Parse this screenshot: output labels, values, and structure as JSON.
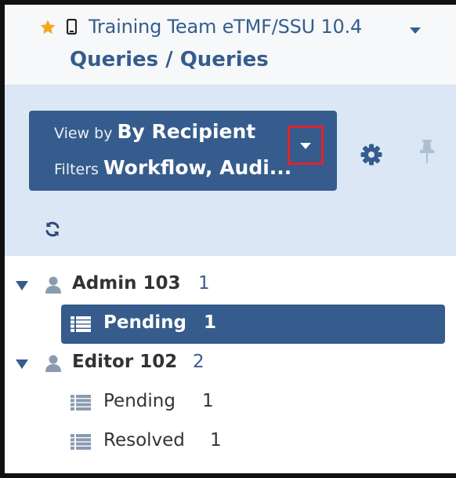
{
  "header": {
    "app_title": "Training Team eTMF/SSU 10.4",
    "page_title": "Queries / Queries"
  },
  "toolbar": {
    "view_by_label": "View by",
    "view_by_value": "By Recipient",
    "filters_label": "Filters",
    "filters_value": "Workflow, Audi..."
  },
  "tree": {
    "groups": [
      {
        "label": "Admin 103",
        "count": "1",
        "items": [
          {
            "label": "Pending",
            "count": "1",
            "selected": true
          }
        ]
      },
      {
        "label": "Editor 102",
        "count": "2",
        "items": [
          {
            "label": "Pending",
            "count": "1",
            "selected": false
          },
          {
            "label": "Resolved",
            "count": "1",
            "selected": false
          }
        ]
      }
    ]
  },
  "icons": {
    "favorite": "star-icon",
    "device": "mobile-device-icon",
    "title_menu": "caret-down-icon",
    "dropdown": "caret-down-icon",
    "settings": "gear-icon",
    "pin": "pin-icon",
    "refresh": "refresh-icon",
    "expand": "triangle-down-icon",
    "user": "user-icon",
    "list": "list-icon"
  },
  "colors": {
    "brand_blue": "#355c8c",
    "toolbar_background": "#dbe7f4",
    "star": "#f5a623",
    "highlight_box": "#e0232a",
    "icon_gray": "#8a9bb0"
  }
}
